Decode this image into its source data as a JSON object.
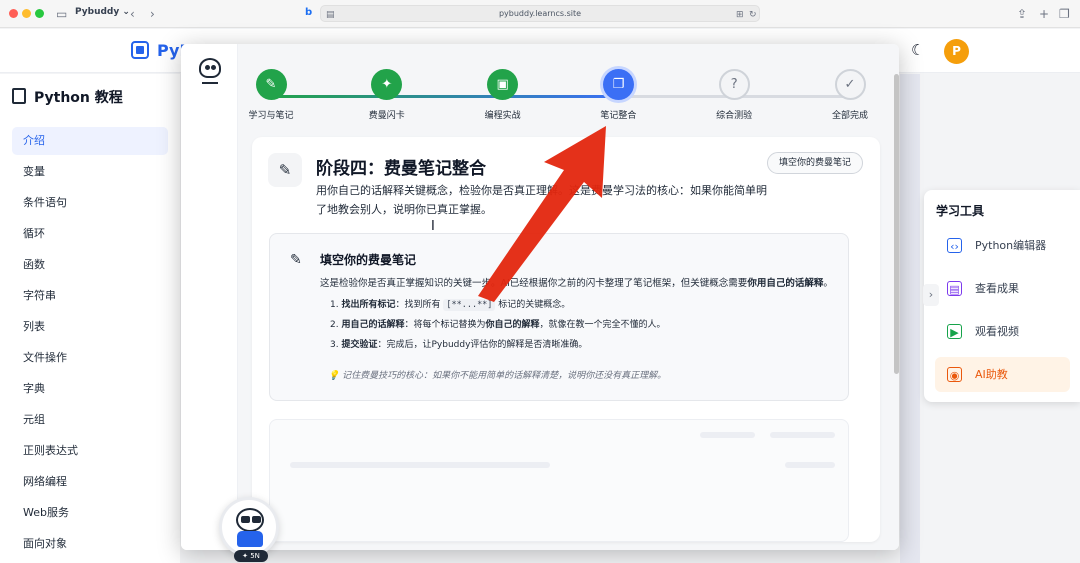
{
  "browser": {
    "tab_title": "Pybuddy",
    "tab_chevron": "⌄",
    "url": "pybuddy.learncs.site"
  },
  "app": {
    "logo_text": "PyB",
    "avatar_letter": "P"
  },
  "sidebar": {
    "title": "Python 教程",
    "items": [
      {
        "label": "介绍"
      },
      {
        "label": "变量"
      },
      {
        "label": "条件语句"
      },
      {
        "label": "循环"
      },
      {
        "label": "函数"
      },
      {
        "label": "字符串"
      },
      {
        "label": "列表"
      },
      {
        "label": "文件操作"
      },
      {
        "label": "字典"
      },
      {
        "label": "元组"
      },
      {
        "label": "正则表达式"
      },
      {
        "label": "网络编程"
      },
      {
        "label": "Web服务"
      },
      {
        "label": "面向对象"
      }
    ],
    "active_index": 0
  },
  "tools": {
    "title": "学习工具",
    "items": [
      {
        "label": "Python编辑器",
        "icon": "code-brackets-icon",
        "glyph": "‹›",
        "color": "#2563eb"
      },
      {
        "label": "查看成果",
        "icon": "document-icon",
        "glyph": "▤",
        "color": "#7c3aed"
      },
      {
        "label": "观看视频",
        "icon": "play-icon",
        "glyph": "▶",
        "color": "#16a34a"
      },
      {
        "label": "AI助教",
        "icon": "robot-icon",
        "glyph": "◉",
        "color": "#ea580c"
      }
    ],
    "active_index": 3
  },
  "stepper": {
    "steps": [
      {
        "label": "学习与笔记",
        "state": "done",
        "glyph": "✎"
      },
      {
        "label": "费曼闪卡",
        "state": "done",
        "glyph": "✦"
      },
      {
        "label": "编程实战",
        "state": "done",
        "glyph": "▣"
      },
      {
        "label": "笔记整合",
        "state": "current",
        "glyph": "❐"
      },
      {
        "label": "综合测验",
        "state": "todo",
        "glyph": "?"
      },
      {
        "label": "全部完成",
        "state": "todo",
        "glyph": "✓"
      }
    ],
    "colors": {
      "done": "#22a34a",
      "current": "#3b6ff5",
      "line_todo": "#d8dbe1"
    }
  },
  "phase": {
    "title": "阶段四：费曼笔记整合",
    "description": "用你自己的话解释关键概念，检验你是否真正理解。这是费曼学习法的核心：如果你能简单明了地教会别人，说明你已真正掌握。",
    "action_label": "填空你的费曼笔记"
  },
  "fill": {
    "title": "填空你的费曼笔记",
    "desc_prefix": "这是检验你是否真正掌握知识的关键一步。AI已经根据你之前的闪卡整理了笔记框架，但关键概念需要",
    "desc_emph": "你用自己的话解释",
    "desc_suffix": "。",
    "steps": [
      {
        "num": "1.",
        "head": "找出所有标记",
        "text_before": "：找到所有 ",
        "code": "[**...**]",
        "text_after": " 标记的关键概念。"
      },
      {
        "num": "2.",
        "head": "用自己的话解释",
        "text_before": "：将每个标记替换为",
        "emph": "你自己的解释",
        "text_after": "，就像在教一个完全不懂的人。"
      },
      {
        "num": "3.",
        "head": "提交验证",
        "text_before": "：完成后，让Pybuddy评估你的解释是否清晰准确。",
        "text_after": ""
      }
    ],
    "tip": "记住费曼技巧的核心：如果你不能用简单的话解释清楚，说明你还没有真正理解。",
    "tip_icon": "💡"
  },
  "mascot": {
    "badge": "✦ 5N"
  }
}
